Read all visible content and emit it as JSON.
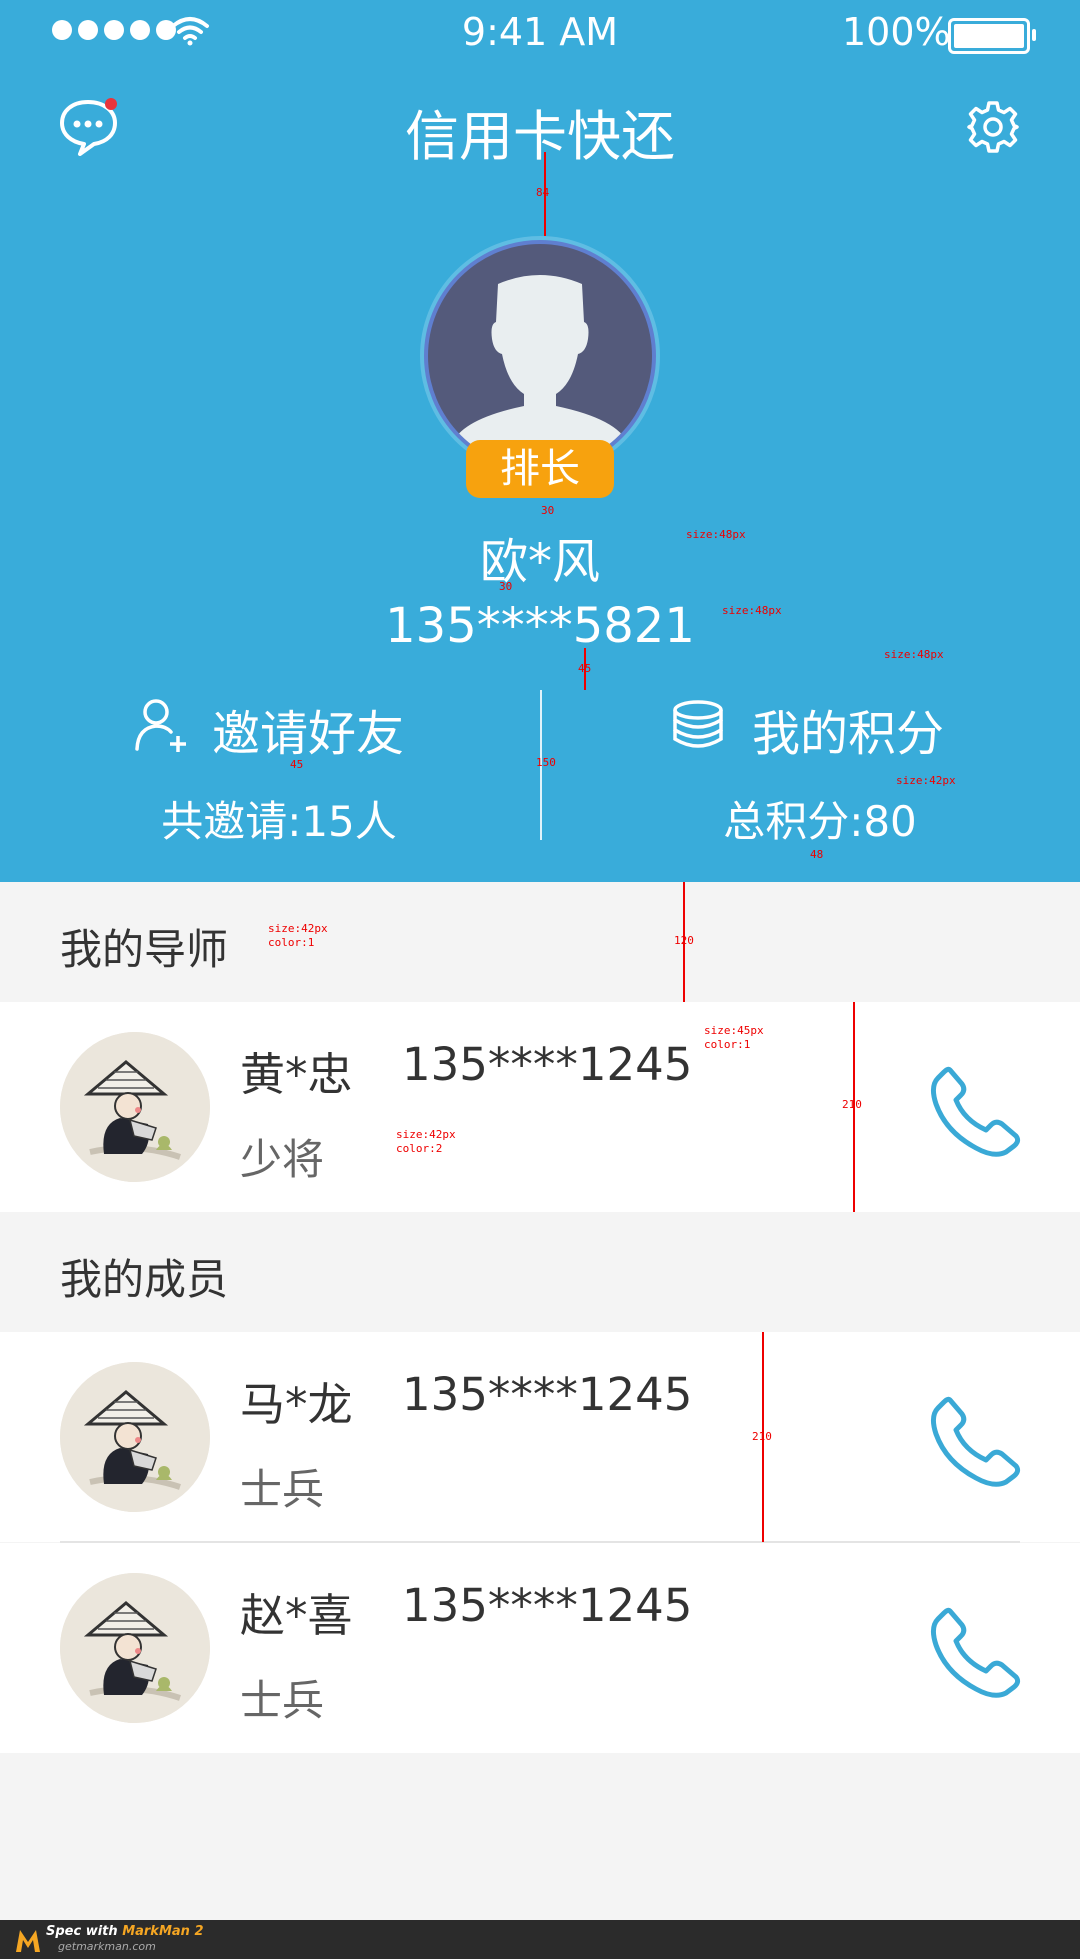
{
  "status_bar": {
    "time": "9:41 AM",
    "battery": "100%"
  },
  "header": {
    "title": "信用卡快还"
  },
  "profile": {
    "rank_badge": "排长",
    "name": "欧*风",
    "phone": "135****5821"
  },
  "stats": {
    "invite_label": "邀请好友",
    "invite_count": "共邀请:15人",
    "points_label": "我的积分",
    "points_total": "总积分:80"
  },
  "mentor_section": {
    "title": "我的导师",
    "items": [
      {
        "name": "黄*忠",
        "phone": "135****1245",
        "rank": "少将"
      }
    ]
  },
  "members_section": {
    "title": "我的成员",
    "items": [
      {
        "name": "马*龙",
        "phone": "135****1245",
        "rank": "士兵"
      },
      {
        "name": "赵*喜",
        "phone": "135****1245",
        "rank": "士兵"
      }
    ]
  },
  "annotations": {
    "a84": "84",
    "a30a": "30",
    "a30b": "30",
    "a45a": "45",
    "a45b": "45",
    "a150": "150",
    "a48": "48",
    "a120": "120",
    "a210a": "210",
    "a210b": "210",
    "s_name": "size:48px",
    "s_phone": "size:48px",
    "s_points": "size:48px",
    "s_total": "size:42px",
    "s_sec1": "size:42px",
    "s_sec1c": "color:1",
    "s_row_phone": "size:45px",
    "s_row_phone_c": "color:1",
    "s_rank": "size:42px",
    "s_rank_c": "color:2"
  },
  "footer": {
    "brand_prefix": "Spec with ",
    "brand_name": "MarkMan 2",
    "url": "getmarkman.com"
  },
  "colors": {
    "primary": "#39acda",
    "badge": "#f7a20e",
    "call": "#3aa9d6",
    "notify_dot": "#e8343b"
  }
}
